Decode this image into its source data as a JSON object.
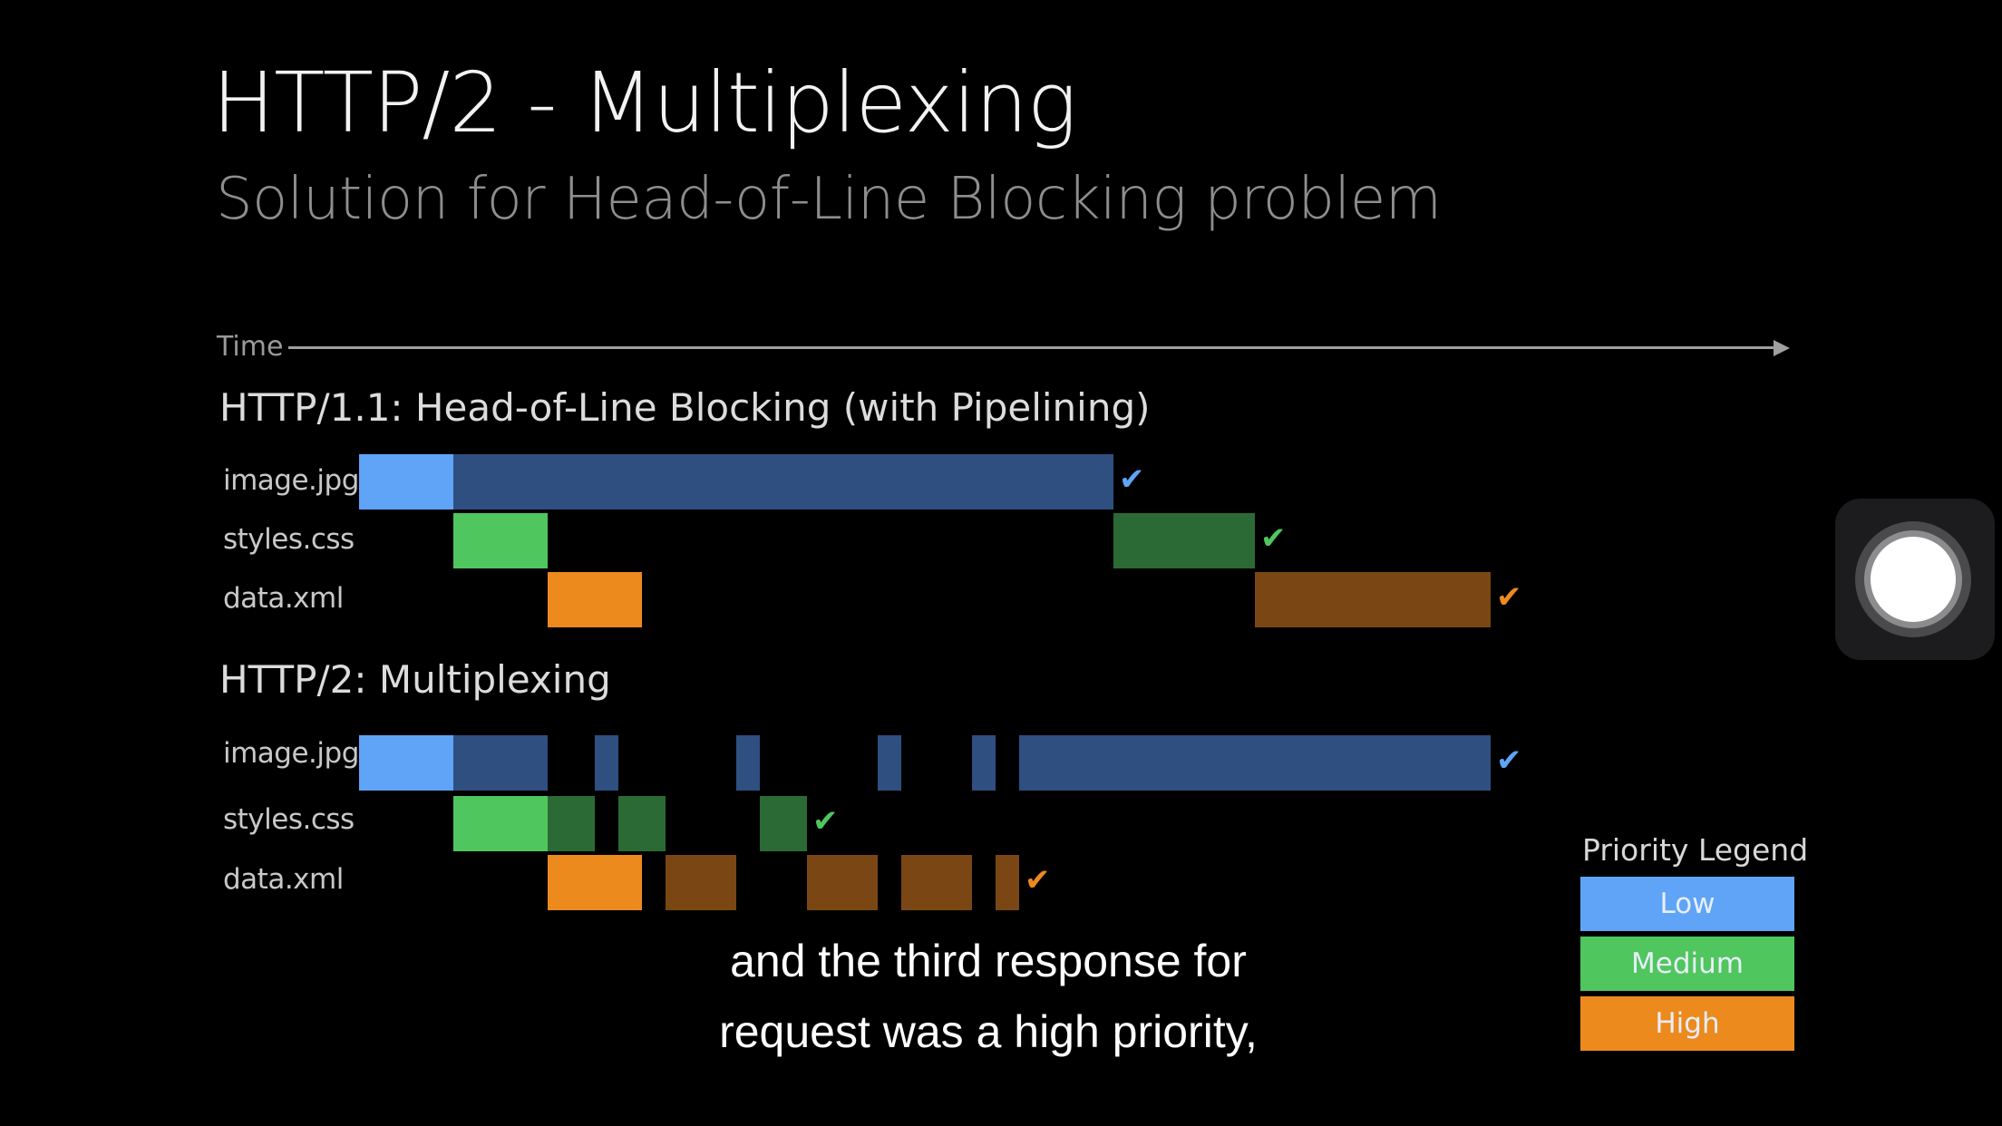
{
  "slide": {
    "title": "HTTP/2 - Multiplexing",
    "subtitle": "Solution for Head-of-Line Blocking problem",
    "time_label": "Time"
  },
  "colors": {
    "low": "#5fa4f7",
    "low_dark": "#2f4f80",
    "medium": "#4fc65e",
    "medium_dark": "#2b6a34",
    "high": "#ec8a1e",
    "high_dark": "#7a4714"
  },
  "sections": [
    {
      "title": "HTTP/1.1:  Head-of-Line Blocking  (with Pipelining)",
      "rows": [
        {
          "label": "image.jpg",
          "priority": "low",
          "check": "✔",
          "segments": [
            {
              "start": 0,
              "end": 1,
              "shade": "light"
            },
            {
              "start": 1,
              "end": 8,
              "shade": "dark"
            }
          ]
        },
        {
          "label": "styles.css",
          "priority": "medium",
          "check": "✔",
          "segments": [
            {
              "start": 1,
              "end": 2,
              "shade": "light"
            },
            {
              "start": 8,
              "end": 9.5,
              "shade": "dark"
            }
          ]
        },
        {
          "label": "data.xml",
          "priority": "high",
          "check": "✔",
          "segments": [
            {
              "start": 2,
              "end": 3,
              "shade": "light"
            },
            {
              "start": 9.5,
              "end": 12,
              "shade": "dark"
            }
          ]
        }
      ]
    },
    {
      "title": "HTTP/2:  Multiplexing",
      "rows": [
        {
          "label": "image.jpg",
          "priority": "low",
          "check": "✔",
          "segments": [
            {
              "start": 0,
              "end": 1,
              "shade": "light"
            },
            {
              "start": 1,
              "end": 2,
              "shade": "dark"
            },
            {
              "start": 2.5,
              "end": 2.75,
              "shade": "dark"
            },
            {
              "start": 4,
              "end": 4.25,
              "shade": "dark"
            },
            {
              "start": 5.5,
              "end": 5.75,
              "shade": "dark"
            },
            {
              "start": 6.5,
              "end": 6.75,
              "shade": "dark"
            },
            {
              "start": 7,
              "end": 12,
              "shade": "dark"
            }
          ]
        },
        {
          "label": "styles.css",
          "priority": "medium",
          "check": "✔",
          "segments": [
            {
              "start": 1,
              "end": 2,
              "shade": "light"
            },
            {
              "start": 2,
              "end": 2.5,
              "shade": "dark"
            },
            {
              "start": 2.75,
              "end": 3.25,
              "shade": "dark"
            },
            {
              "start": 4.25,
              "end": 4.75,
              "shade": "dark"
            }
          ]
        },
        {
          "label": "data.xml",
          "priority": "high",
          "check": "✔",
          "segments": [
            {
              "start": 2,
              "end": 3,
              "shade": "light"
            },
            {
              "start": 3.25,
              "end": 4,
              "shade": "dark"
            },
            {
              "start": 4.75,
              "end": 5.5,
              "shade": "dark"
            },
            {
              "start": 5.75,
              "end": 6.5,
              "shade": "dark"
            },
            {
              "start": 6.75,
              "end": 7,
              "shade": "dark"
            }
          ]
        }
      ]
    }
  ],
  "legend": {
    "title": "Priority Legend",
    "items": [
      {
        "label": "Low",
        "color": "#5fa4f7"
      },
      {
        "label": "Medium",
        "color": "#4fc65e"
      },
      {
        "label": "High",
        "color": "#ec8a1e"
      }
    ]
  },
  "caption": {
    "line1": "and the third response for",
    "line2": "request was a high priority,"
  },
  "assistive_touch": {
    "icon": "assistive-touch-icon"
  }
}
